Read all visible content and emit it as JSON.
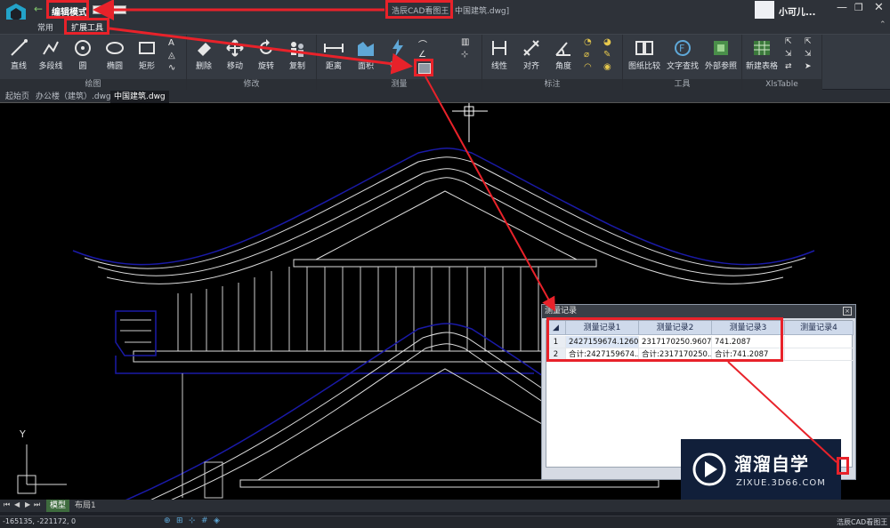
{
  "window": {
    "title_app": "浩辰CAD看图王",
    "title_doc": "中国建筑.dwg]",
    "edit_mode": "编辑模式",
    "user": "小可儿..."
  },
  "menu": {
    "tabs": [
      "常用",
      "扩展工具"
    ]
  },
  "ribbon": {
    "draw_group": "绘图",
    "modify_group": "修改",
    "measure_group": "测量",
    "annot_group": "标注",
    "tools_group": "工具",
    "xls_group": "XlsTable",
    "draw_buttons": [
      "直线",
      "多段线",
      "圆",
      "椭圆",
      "矩形"
    ],
    "modify_buttons": [
      "删除",
      "移动",
      "旋转",
      "复制"
    ],
    "measure_buttons": [
      "距离",
      "面积",
      "快速"
    ],
    "annot_buttons": [
      "线性",
      "对齐",
      "角度"
    ],
    "tool_buttons": [
      "图纸比较",
      "文字查找",
      "外部参照"
    ],
    "xls_buttons": [
      "新建表格"
    ]
  },
  "doc_tabs": [
    "起始页",
    "办公楼（建筑）.dwg",
    "中国建筑.dwg"
  ],
  "layout_tabs": [
    "模型",
    "布局1"
  ],
  "status": {
    "coords": "-165135, -221172, 0",
    "right_app": "浩辰CAD看图王"
  },
  "panel": {
    "title": "测量记录",
    "headers": [
      "测量记录1",
      "测量记录2",
      "测量记录3",
      "测量记录4"
    ],
    "rows": [
      {
        "num": "1",
        "cells": [
          "2427159674.1260",
          "2317170250.9607",
          "741.2087",
          ""
        ]
      },
      {
        "num": "2",
        "cells": [
          "合计:2427159674...",
          "合计:2317170250...",
          "合计:741.2087",
          ""
        ]
      }
    ]
  },
  "watermark": {
    "brand": "溜溜自学",
    "url": "ZIXUE.3D66.COM"
  },
  "colors": {
    "highlight": "#e8222a",
    "ribbon_bg": "#353a42",
    "canvas_bg": "#000000",
    "outline_blue": "#1a1aa8"
  }
}
